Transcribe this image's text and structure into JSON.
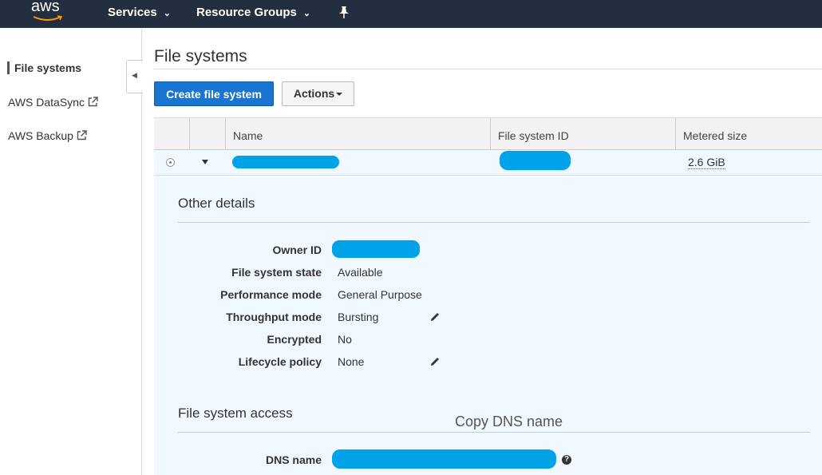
{
  "header": {
    "logo_text": "aws",
    "services_label": "Services",
    "resource_groups_label": "Resource Groups"
  },
  "sidebar": {
    "items": [
      {
        "label": "File systems"
      },
      {
        "label": "AWS DataSync"
      },
      {
        "label": "AWS Backup"
      }
    ]
  },
  "main": {
    "title": "File systems",
    "create_button": "Create file system",
    "actions_button": "Actions",
    "table": {
      "columns": [
        "Name",
        "File system ID",
        "Metered size"
      ],
      "rows": [
        {
          "name": "",
          "file_system_id": "",
          "metered_size": "2.6 GiB"
        }
      ]
    },
    "other_details": {
      "title": "Other details",
      "fields": [
        {
          "label": "Owner ID",
          "value": ""
        },
        {
          "label": "File system state",
          "value": "Available"
        },
        {
          "label": "Performance mode",
          "value": "General Purpose"
        },
        {
          "label": "Throughput mode",
          "value": "Bursting"
        },
        {
          "label": "Encrypted",
          "value": "No"
        },
        {
          "label": "Lifecycle policy",
          "value": "None"
        }
      ]
    },
    "access": {
      "title": "File system access",
      "dns_label": "DNS name",
      "dns_value": "",
      "annotation": "Copy DNS name"
    }
  },
  "colors": {
    "nav_bg": "#232f3e",
    "primary": "#1a75d2",
    "redaction": "#00a2e8",
    "detail_bg": "#f2f8ff"
  }
}
